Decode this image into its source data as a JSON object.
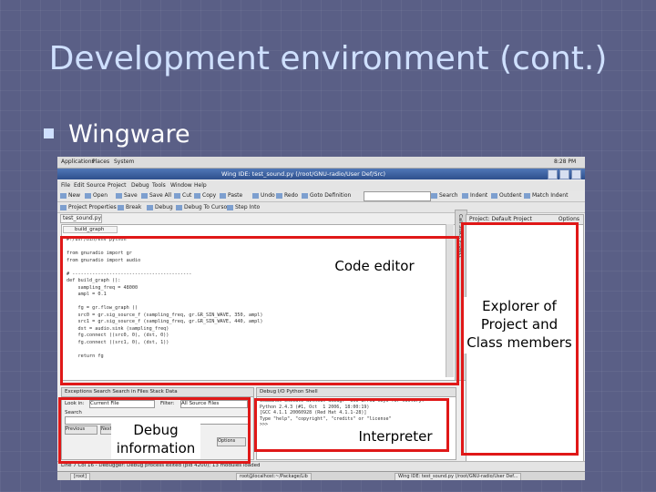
{
  "slide": {
    "title": "Development environment (cont.)",
    "bullet": "Wingware"
  },
  "ide": {
    "gnome_menu": [
      "Applications",
      "Places",
      "System"
    ],
    "clock": "8:28 PM",
    "window_title": "Wing IDE: test_sound.py (/root/GNU-radio/User Def/Src)",
    "menu": [
      "File",
      "Edit",
      "Source",
      "Project",
      "Debug",
      "Tools",
      "Window",
      "Help"
    ],
    "toolbar": [
      "New",
      "Open",
      "Save",
      "Save All",
      "Cut",
      "Copy",
      "Paste",
      "Undo",
      "Redo",
      "Goto Definition",
      "Search",
      "Indent",
      "Outdent",
      "Match Indent"
    ],
    "toolbar2": [
      "Project Properties",
      "Break",
      "Debug",
      "Debug To Cursor",
      "Step Into"
    ],
    "file_tab": "test_sound.py",
    "function_selector": "build_graph",
    "code_lines": [
      "#!/usr/bin/env python",
      "",
      "from gnuradio import gr",
      "from gnuradio import audio",
      "",
      "# ------------------------------------------",
      "def build_graph ():",
      "    sampling_freq = 48000",
      "    ampl = 0.1",
      "",
      "    fg = gr.flow_graph ()",
      "    src0 = gr.sig_source_f (sampling_freq, gr.GR_SIN_WAVE, 350, ampl)",
      "    src1 = gr.sig_source_f (sampling_freq, gr.GR_SIN_WAVE, 440, ampl)",
      "    dst = audio.sink (sampling_freq)",
      "    fg.connect ((src0, 0), (dst, 0))",
      "    fg.connect ((src1, 0), (dst, 1))",
      "",
      "    return fg"
    ],
    "sidebar_tabs": "Call Stack  Project",
    "project_header": "Project: Default Project",
    "project_options": "Options",
    "bottom_left_tabs": "Exceptions  Search  Search in Files  Stack Data",
    "look_in_label": "Look in:",
    "look_in_value": "Current File",
    "filter_label": "Filter:",
    "filter_value": "All Source Files",
    "search_label": "Search",
    "previous_button": "Previous",
    "next_button": "Next",
    "options_button": "Options",
    "bottom_right_tabs": "Debug I/O  Python Shell",
    "interpreter_lines": [
      "Commands execute without debug.  Use arrow keys for history.",
      "Python 2.4.3 (#1, Oct  1 2006, 18:00:19)",
      "[GCC 4.1.1 20060928 (Red Hat 4.1.1-28)]",
      "Type \"help\", \"copyright\", \"credits\" or \"license\"",
      ">>>"
    ],
    "status": "Line 7 Col 16 - Debugger: Debug process exited (pid 4200); 13 modules loaded",
    "taskbar": [
      "[root]",
      "root@localhost:~/Package/Lib",
      "Wing IDE: test_sound.py (/root/GNU-radio/User Def..."
    ]
  },
  "callouts": {
    "code_editor": "Code editor",
    "explorer_line1": "Explorer of",
    "explorer_line2": "Project and",
    "explorer_line3": "Class members",
    "debug_line1": "Debug",
    "debug_line2": "information",
    "interpreter": "Interpreter"
  },
  "colors": {
    "background": "#5a5f86",
    "title": "#cfe0ff",
    "highlight": "#e01818"
  }
}
